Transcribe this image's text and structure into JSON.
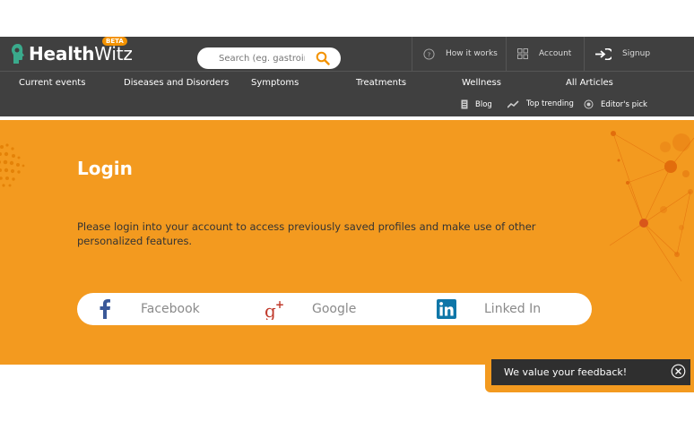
{
  "brand": {
    "name_bold": "Health",
    "name_light": "Witz",
    "badge": "BETA"
  },
  "search": {
    "placeholder": "Search (eg. gastrointestinal)"
  },
  "topnav": [
    {
      "label": "How it works",
      "icon": "question-circle-icon"
    },
    {
      "label": "Account",
      "icon": "grid-icon"
    },
    {
      "label": "Signup",
      "icon": "signup-arrow-icon"
    }
  ],
  "menu": [
    "Current events",
    "Diseases and Disorders",
    "Symptoms",
    "Treatments",
    "Wellness",
    "All Articles"
  ],
  "submenu": [
    {
      "label": "Blog",
      "icon": "blog-icon"
    },
    {
      "label": "Top trending",
      "icon": "trending-icon"
    },
    {
      "label": "Editor's pick",
      "icon": "target-icon"
    }
  ],
  "login": {
    "title": "Login",
    "description": "Please login into your account to access previously saved profiles and make use of other personalized features."
  },
  "social": [
    {
      "label": "Facebook",
      "icon": "facebook-icon",
      "color": "#3b5998"
    },
    {
      "label": "Google",
      "icon": "google-plus-icon",
      "color": "#c0392b"
    },
    {
      "label": "Linked In",
      "icon": "linkedin-icon",
      "color": "#0e76a8"
    }
  ],
  "feedback": {
    "label": "We value your feedback!"
  },
  "colors": {
    "header": "#404040",
    "accent": "#f39a1f",
    "beta": "#f39200"
  }
}
